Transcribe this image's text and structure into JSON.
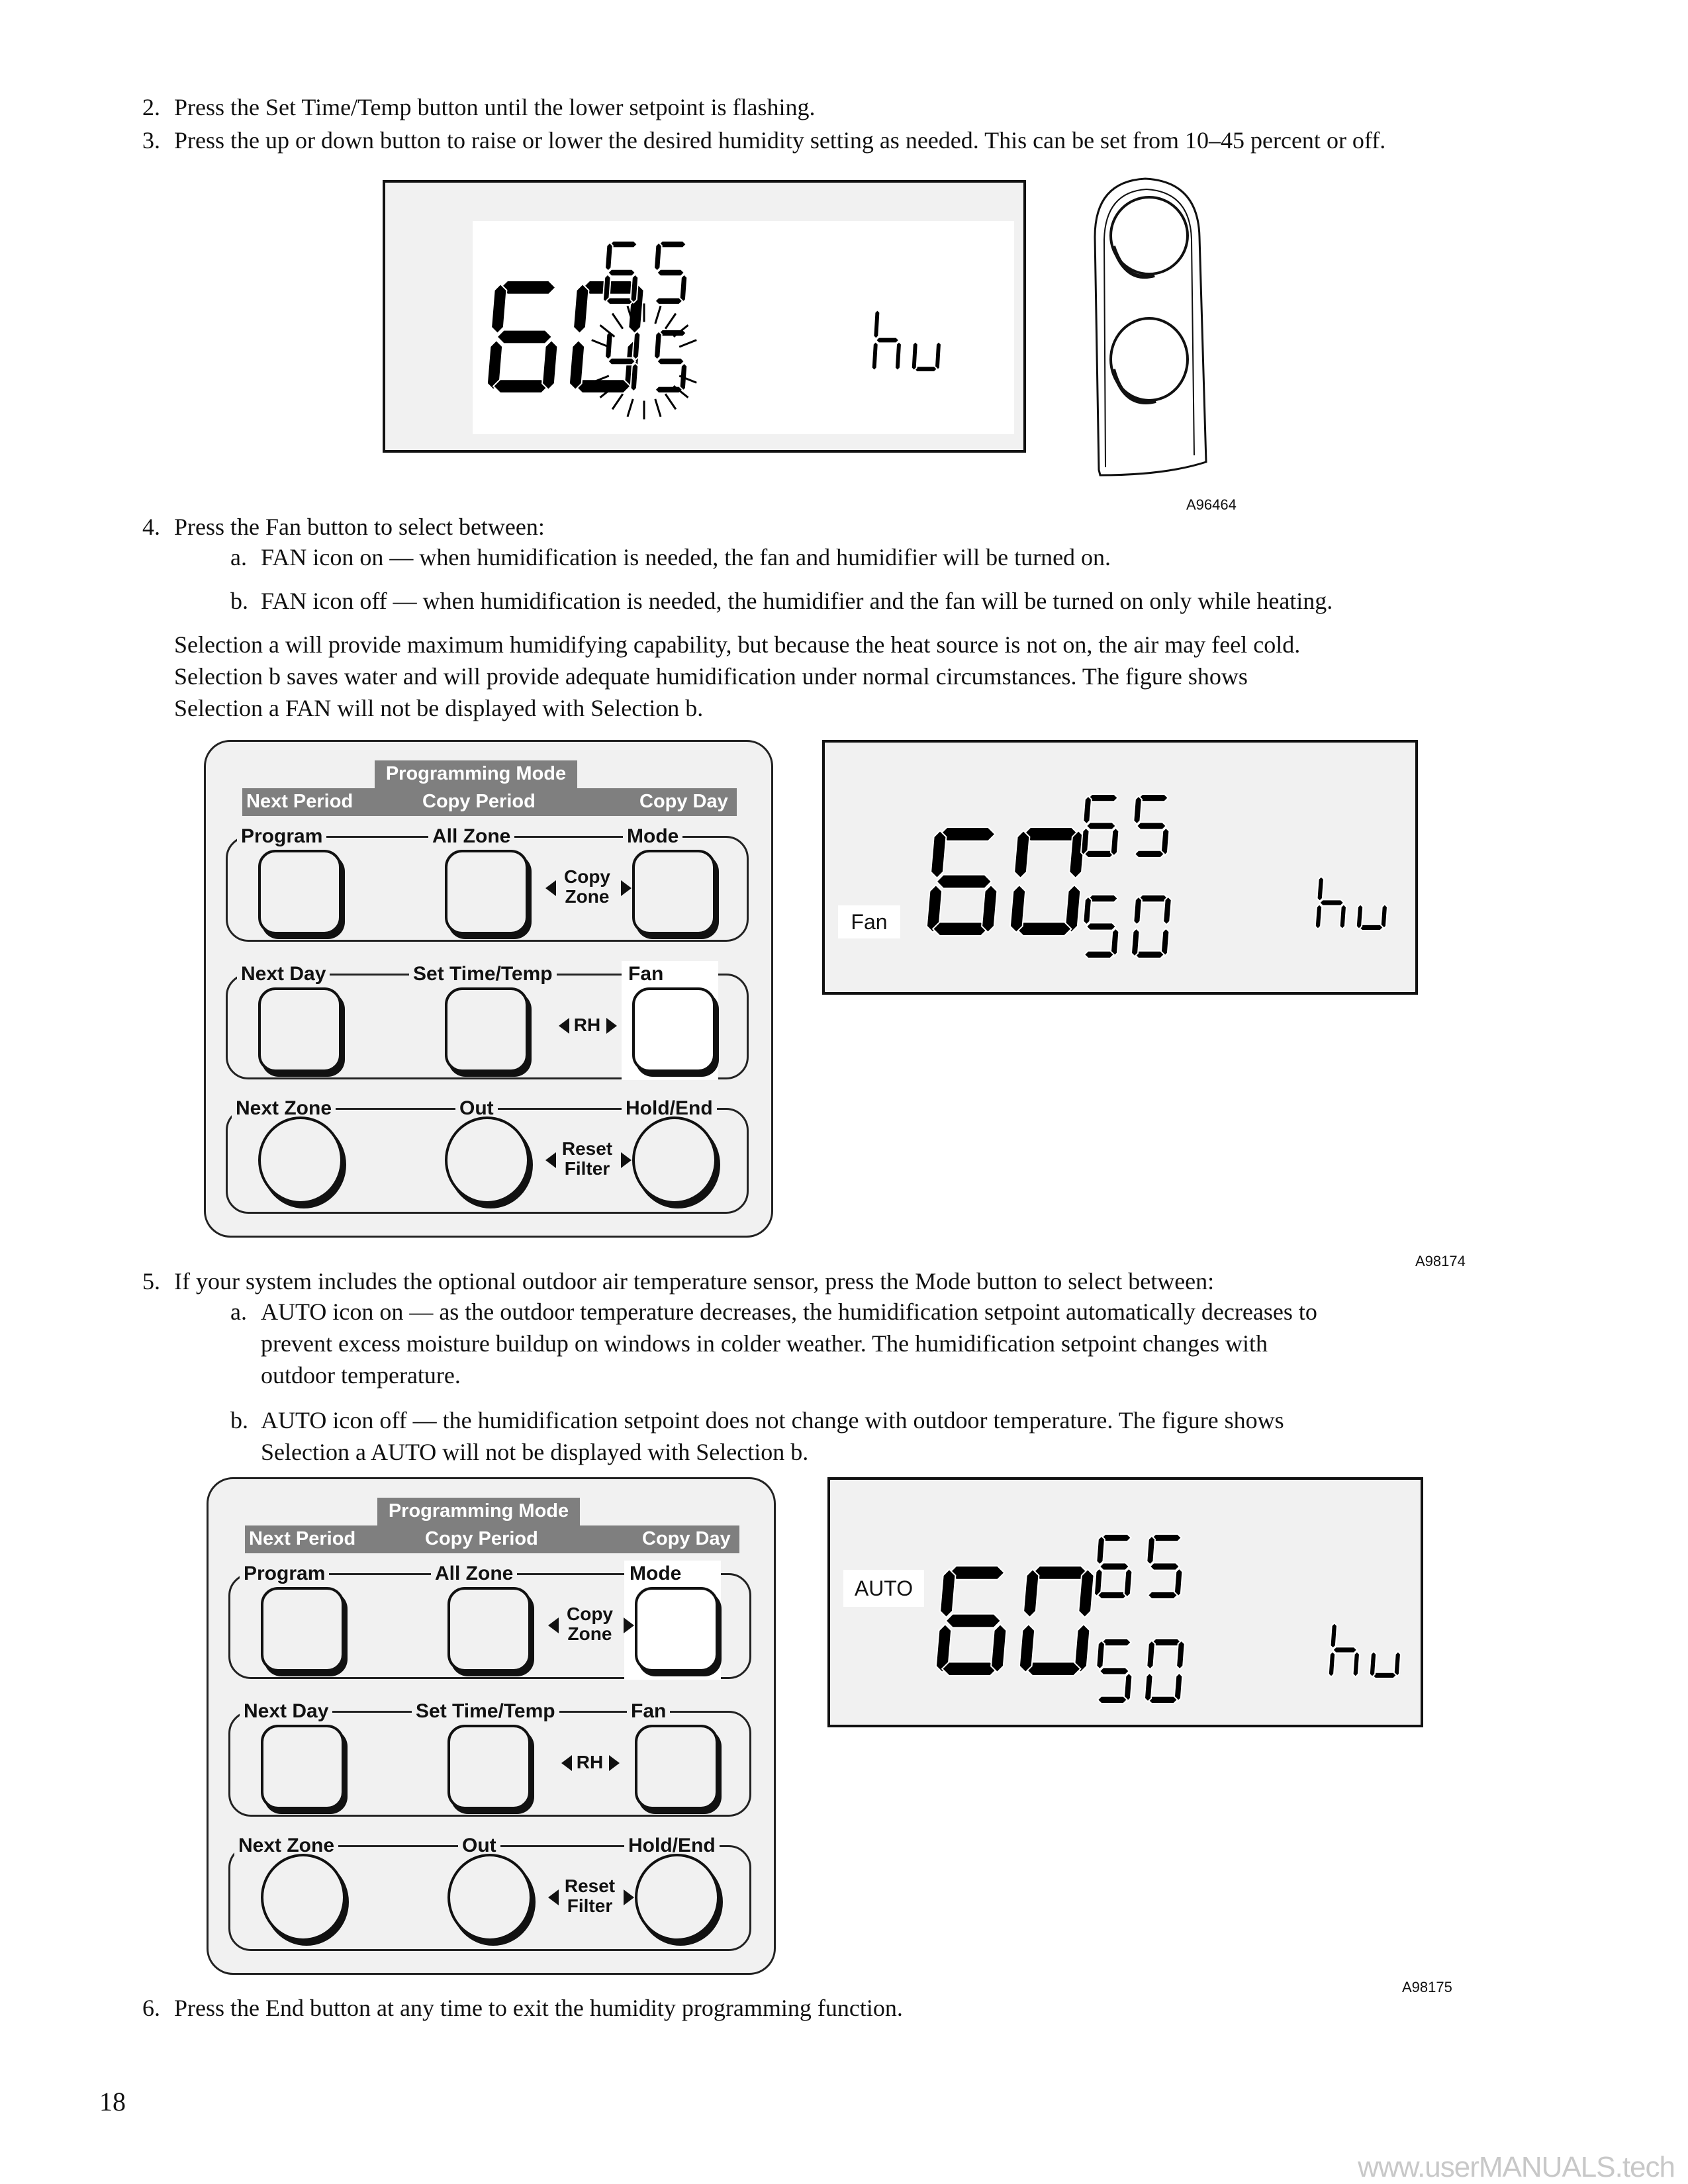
{
  "steps": {
    "step2": {
      "num": "2.",
      "text": "Press the Set Time/Temp button until the lower setpoint is flashing."
    },
    "step3": {
      "num": "3.",
      "text": "Press the up or down button to raise or lower the desired humidity setting as needed. This can be set from 10–45 percent or off."
    },
    "step4": {
      "num": "4.",
      "text": "Press the Fan button to select between:",
      "a": {
        "marker": "a.",
        "text": "FAN icon on — when humidification is needed, the fan and humidifier will be turned on."
      },
      "b": {
        "marker": "b.",
        "text": "FAN icon off — when humidification is needed, the humidifier and the fan will be turned on only while heating."
      },
      "note": [
        "Selection a will provide maximum humidifying capability, but because the heat source is not on, the air may feel cold.",
        "Selection b saves water and will provide adequate humidification under normal circumstances. The figure shows",
        "Selection a FAN will not be displayed with Selection b."
      ]
    },
    "step5": {
      "num": "5.",
      "text": "If your system includes the optional outdoor air temperature sensor, press the Mode button to select between:",
      "a": {
        "marker": "a.",
        "lines": [
          "AUTO icon on — as the outdoor temperature decreases, the humidification setpoint automatically decreases to",
          "prevent excess moisture buildup on windows in colder weather. The humidification setpoint changes with",
          "outdoor temperature."
        ]
      },
      "b": {
        "marker": "b.",
        "lines": [
          "AUTO icon off — the humidification setpoint does not change with outdoor temperature. The figure shows",
          "Selection a AUTO will not be displayed with Selection b."
        ]
      }
    },
    "step6": {
      "num": "6.",
      "text": "Press the End button at any time to exit the humidity programming function."
    }
  },
  "figures": {
    "fig1": {
      "id": "A96464",
      "display": {
        "current": "60",
        "upper": "65",
        "lower": "45",
        "unit": "hu",
        "lower_flashing": true
      }
    },
    "fig2": {
      "id": "A98174",
      "display": {
        "icon": "Fan",
        "current": "60",
        "upper": "65",
        "lower": "50",
        "unit": "hu"
      },
      "highlighted_button": "Fan"
    },
    "fig3": {
      "id": "A98175",
      "display": {
        "icon": "AUTO",
        "current": "60",
        "upper": "65",
        "lower": "50",
        "unit": "hu"
      },
      "highlighted_button": "Mode"
    }
  },
  "keypad": {
    "banner_title": "Programming Mode",
    "banner_items": [
      "Next Period",
      "Copy Period",
      "Copy Day"
    ],
    "row1": {
      "labels": [
        "Program",
        "All Zone",
        "Mode"
      ],
      "middle": [
        "Copy",
        "Zone"
      ]
    },
    "row2": {
      "labels": [
        "Next Day",
        "Set Time/Temp",
        "Fan"
      ],
      "middle": [
        "RH"
      ]
    },
    "row3": {
      "labels": [
        "Next Zone",
        "Out",
        "Hold/End"
      ],
      "middle": [
        "Reset",
        "Filter"
      ]
    }
  },
  "page_number": "18",
  "watermark": "www.userMANUALS.tech"
}
